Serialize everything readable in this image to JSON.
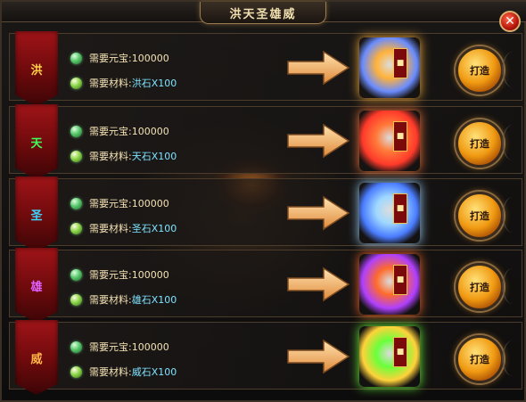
{
  "window": {
    "title": "洪天圣雄威",
    "close_label": "✕"
  },
  "rows": [
    {
      "tab_label": "洪",
      "tab_color": "#ffd24a",
      "yuanbao_label": "需要元宝:",
      "yuanbao_value": "100000",
      "material_label": "需要材料:",
      "material_value": "洪石X100",
      "forge_label": "打造",
      "glow": [
        "#ffb23a",
        "#6a8cff"
      ]
    },
    {
      "tab_label": "天",
      "tab_color": "#3cff5a",
      "yuanbao_label": "需要元宝:",
      "yuanbao_value": "100000",
      "material_label": "需要材料:",
      "material_value": "天石X100",
      "forge_label": "打造",
      "glow": [
        "#ff7a3a",
        "#ff3a2a"
      ]
    },
    {
      "tab_label": "圣",
      "tab_color": "#3ad8ff",
      "yuanbao_label": "需要元宝:",
      "yuanbao_value": "100000",
      "material_label": "需要材料:",
      "material_value": "圣石X100",
      "forge_label": "打造",
      "glow": [
        "#9fd8ff",
        "#4a7cff"
      ]
    },
    {
      "tab_label": "雄",
      "tab_color": "#e060ff",
      "yuanbao_label": "需要元宝:",
      "yuanbao_value": "100000",
      "material_label": "需要材料:",
      "material_value": "雄石X100",
      "forge_label": "打造",
      "glow": [
        "#ff6a2a",
        "#b040ff"
      ]
    },
    {
      "tab_label": "威",
      "tab_color": "#ffb347",
      "yuanbao_label": "需要元宝:",
      "yuanbao_value": "100000",
      "material_label": "需要材料:",
      "material_value": "威石X100",
      "forge_label": "打造",
      "glow": [
        "#6aff3a",
        "#ffd23a"
      ]
    }
  ]
}
